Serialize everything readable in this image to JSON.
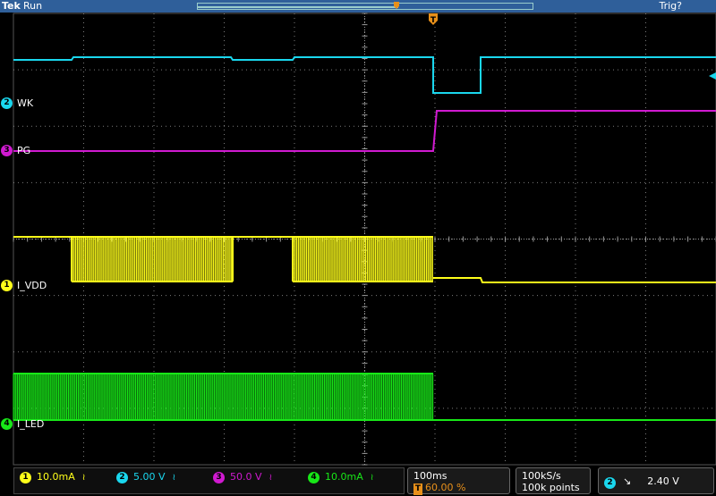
{
  "header": {
    "brand": "Tek",
    "run_state": "Run",
    "trigger_status": "Trig?"
  },
  "colors": {
    "ch1": "#ffff1a",
    "ch2": "#1ad7ee",
    "ch3": "#d01ad0",
    "ch4": "#18e818",
    "graticule": "#9a9a9a",
    "trigger": "#e8901a",
    "header": "#2f5f9a"
  },
  "trigger_marker_icon": "t-icon",
  "channels": [
    {
      "num": "2",
      "label": "WK",
      "color": "#1ad7ee"
    },
    {
      "num": "3",
      "label": "PG",
      "color": "#d01ad0"
    },
    {
      "num": "1",
      "label": "I_VDD",
      "color": "#ffff1a"
    },
    {
      "num": "4",
      "label": "I_LED",
      "color": "#18e818"
    }
  ],
  "vertical_readouts": [
    {
      "num": "1",
      "value": "10.0mA",
      "coupling": "≀",
      "color": "#ffff1a"
    },
    {
      "num": "2",
      "value": "5.00 V",
      "coupling": "≀",
      "color": "#1ad7ee"
    },
    {
      "num": "3",
      "value": "50.0 V",
      "coupling": "≀",
      "color": "#d01ad0"
    },
    {
      "num": "4",
      "value": "10.0mA",
      "coupling": "≀",
      "color": "#18e818"
    }
  ],
  "timebase": {
    "scale": "100ms",
    "trigger_position_marker": "T",
    "trigger_position": "60.00 %"
  },
  "acquisition": {
    "sample_rate": "100kS/s",
    "record_length": "100k points"
  },
  "trigger": {
    "source": "2",
    "slope_icon": "falling-edge-icon",
    "slope_glyph": "↘",
    "level": "2.40 V"
  },
  "record_view": {
    "trigger_fraction": 0.6
  }
}
